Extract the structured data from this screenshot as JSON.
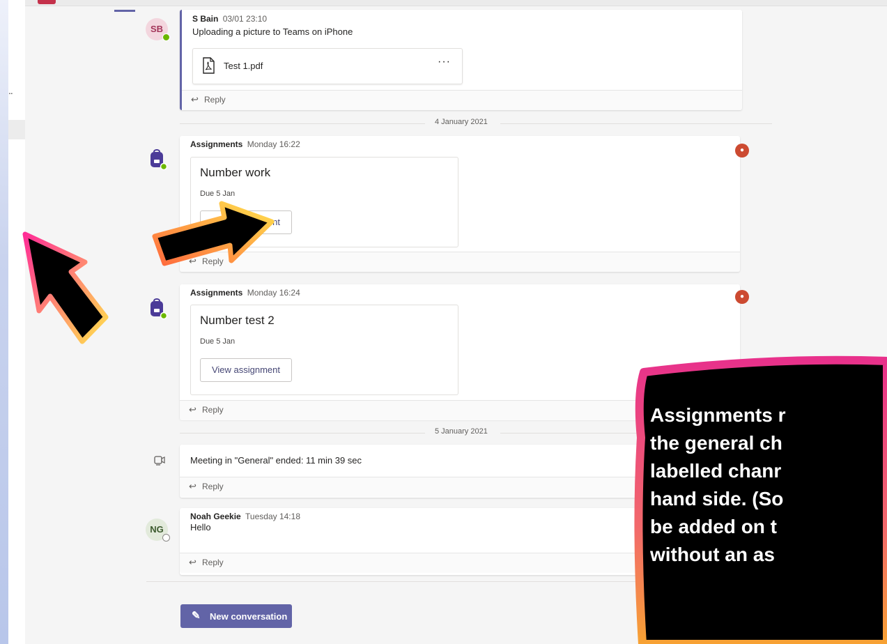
{
  "posts": [
    {
      "author": "S Bain",
      "time": "03/01 23:10",
      "initials": "SB",
      "text": "Uploading a picture to Teams on iPhone",
      "attachment": {
        "name": "Test 1.pdf",
        "menu": "···"
      }
    },
    {
      "author": "Assignments",
      "time": "Monday 16:22",
      "title": "Number work",
      "due": "Due 5 Jan",
      "button": "View assignment"
    },
    {
      "author": "Assignments",
      "time": "Monday 16:24",
      "title": "Number test 2",
      "due": "Due 5 Jan",
      "button": "View assignment"
    },
    {
      "text": "Meeting in \"General\" ended: 11 min 39 sec"
    },
    {
      "author": "Noah Geekie",
      "time": "Tuesday 14:18",
      "initials": "NG",
      "text": "Hello"
    }
  ],
  "reply_label": "Reply",
  "dates": [
    "4 January 2021",
    "5 January 2021"
  ],
  "new_conversation_label": "New conversation",
  "left_panel_more": "..",
  "callout_lines": [
    "Assignments r",
    "the general ch",
    "labelled chanr",
    "hand side. (So",
    "be added on t",
    "without an as"
  ],
  "colors": {
    "accent": "#6264a7",
    "badge": "#cc4a31",
    "presence_available": "#6bb700",
    "callout_fill": "#000000",
    "callout_border": [
      "#e8318b",
      "#f7a233"
    ],
    "arrow_fill": "#000000",
    "arrow_border": [
      "#ff2d96",
      "#ffe14d"
    ]
  },
  "icons": {
    "pdf": "pdf-file-icon",
    "meeting": "meeting-ended-icon",
    "new_conversation": "compose-icon",
    "assignments": "backpack-icon",
    "reply": "reply-arrow-icon",
    "badge": "team-icon"
  }
}
